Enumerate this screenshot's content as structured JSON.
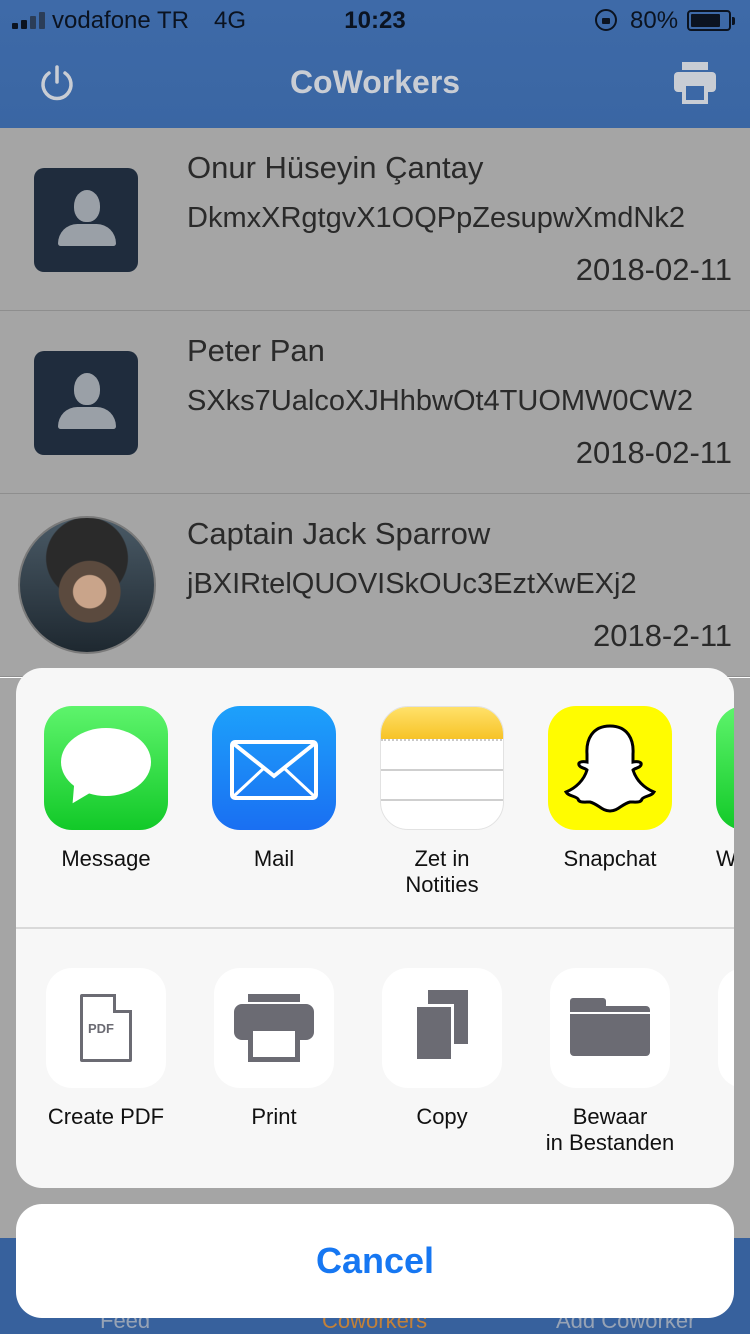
{
  "status_bar": {
    "carrier": "vodafone TR",
    "network": "4G",
    "time": "10:23",
    "battery": "80%"
  },
  "nav": {
    "title": "CoWorkers",
    "left_icon": "power-icon",
    "right_icon": "printer-icon"
  },
  "coworkers": [
    {
      "name": "Onur Hüseyin Çantay",
      "uid": "DkmxXRgtgvX1OQPpZesupwXmdNk2",
      "date": "2018-02-11",
      "avatar": "placeholder"
    },
    {
      "name": "Peter Pan",
      "uid": "SXks7UalcoXJHhbwOt4TUOMW0CW2",
      "date": "2018-02-11",
      "avatar": "placeholder"
    },
    {
      "name": "Captain Jack Sparrow",
      "uid": "jBXIRtelQUOVISkOUc3EztXwEXj2",
      "date": "2018-2-11",
      "avatar": "photo"
    }
  ],
  "tabs": [
    {
      "label": "Feed",
      "active": false
    },
    {
      "label": "Coworkers",
      "active": true
    },
    {
      "label": "Add Coworker",
      "active": false
    }
  ],
  "share_sheet": {
    "apps": [
      {
        "label": "Message",
        "icon": "message-icon",
        "color": "#19cf2f"
      },
      {
        "label": "Mail",
        "icon": "mail-icon",
        "color": "#1a8cf7"
      },
      {
        "label": "Zet in\nNotities",
        "icon": "notes-icon",
        "color": "#f9cc33"
      },
      {
        "label": "Snapchat",
        "icon": "snapchat-icon",
        "color": "#fffc00"
      },
      {
        "label": "W",
        "icon": "partial-app-icon"
      }
    ],
    "actions": [
      {
        "label": "Create PDF",
        "icon": "pdf-icon",
        "icon_text": "PDF"
      },
      {
        "label": "Print",
        "icon": "print-icon"
      },
      {
        "label": "Copy",
        "icon": "copy-icon"
      },
      {
        "label": "Bewaar\nin Bestanden",
        "icon": "folder-icon"
      }
    ],
    "cancel_label": "Cancel"
  },
  "colors": {
    "nav_bar": "#3e6aa8",
    "cancel_text": "#1677f2",
    "active_tab": "#c2813a"
  }
}
